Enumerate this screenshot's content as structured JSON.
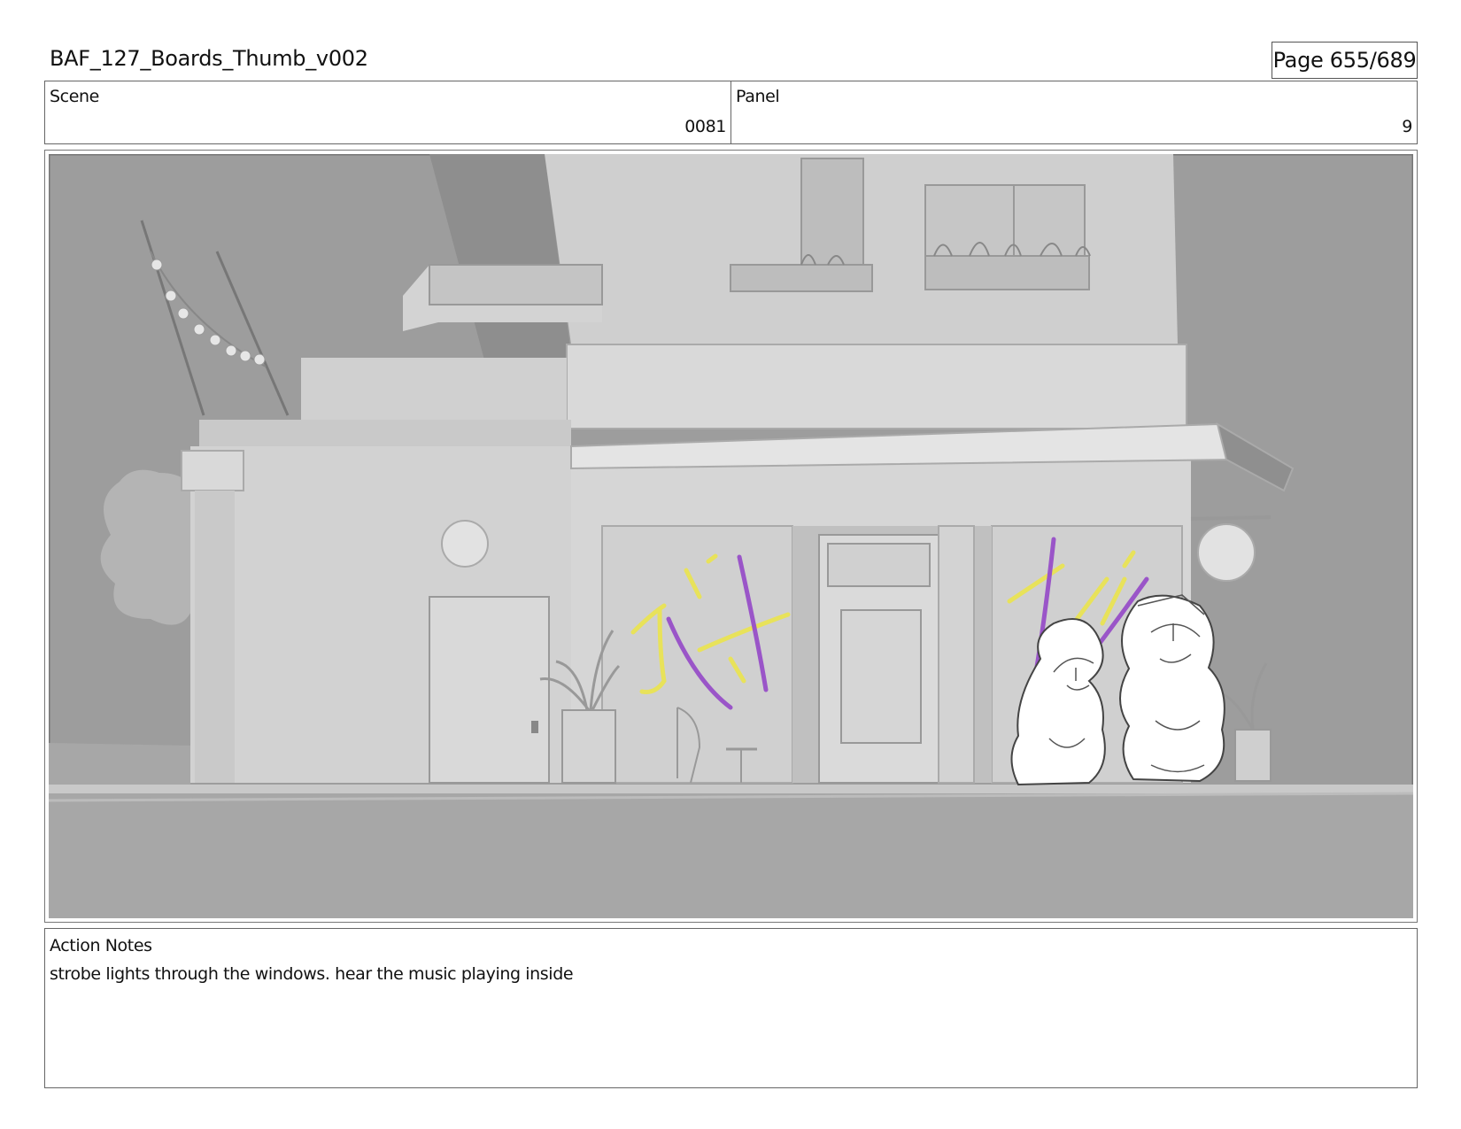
{
  "document": {
    "title": "BAF_127_Boards_Thumb_v002",
    "page": "Page 655/689"
  },
  "scene": {
    "label": "Scene",
    "value": "0081"
  },
  "panel": {
    "label": "Panel",
    "value": "9"
  },
  "action_notes": {
    "label": "Action Notes",
    "text": "strobe lights through the windows. hear the music playing inside"
  },
  "colors": {
    "strobe_yellow": "#e8e25a",
    "strobe_purple": "#9a55c8",
    "background_grey": "#9c9c9c",
    "building_grey": "#d6d6d6"
  }
}
